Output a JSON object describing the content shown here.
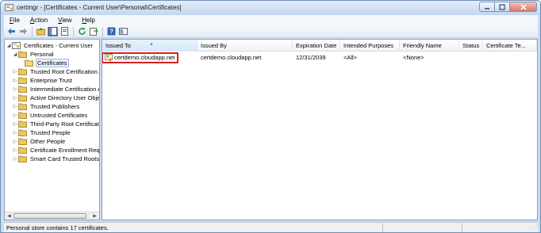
{
  "window": {
    "title": "certmgr - [Certificates - Current User\\Personal\\Certificates]"
  },
  "menu": [
    {
      "label": "File",
      "key": "F",
      "rest": "ile"
    },
    {
      "label": "Action",
      "key": "A",
      "rest": "ction"
    },
    {
      "label": "View",
      "key": "V",
      "rest": "iew"
    },
    {
      "label": "Help",
      "key": "H",
      "rest": "elp"
    }
  ],
  "toolbar": {
    "icons": [
      "back-arrow-icon",
      "forward-arrow-icon",
      "up-folder-icon",
      "show-hide-tree-icon",
      "properties-icon",
      "refresh-icon",
      "export-list-icon",
      "help-icon",
      "mmc-console-icon"
    ]
  },
  "tree": {
    "root": "Certificates - Current User",
    "personal": "Personal",
    "certificates": "Certificates",
    "items": [
      "Trusted Root Certification Au",
      "Enterprise Trust",
      "Intermediate Certification Au",
      "Active Directory User Object",
      "Trusted Publishers",
      "Untrusted Certificates",
      "Third-Party Root Certification",
      "Trusted People",
      "Other People",
      "Certificate Enrollment Reques",
      "Smart Card Trusted Roots"
    ]
  },
  "list": {
    "columns": [
      "Issued To",
      "Issued By",
      "Expiration Date",
      "Intended Purposes",
      "Friendly Name",
      "Status",
      "Certificate Te..."
    ],
    "sorted_column": "Issued To",
    "rows": [
      {
        "issued_to": "certdemo.cloudapp.net",
        "issued_by": "certdemo.cloudapp.net",
        "expiration": "12/31/2039",
        "purposes": "<All>",
        "friendly_name": "<None>",
        "status": "",
        "template": ""
      }
    ]
  },
  "status": {
    "text": "Personal store contains 17 certificates."
  },
  "colors": {
    "highlight_border": "#d62020",
    "selection_bg": "#e8f1fc",
    "window_frame": "#c9dcf2"
  }
}
